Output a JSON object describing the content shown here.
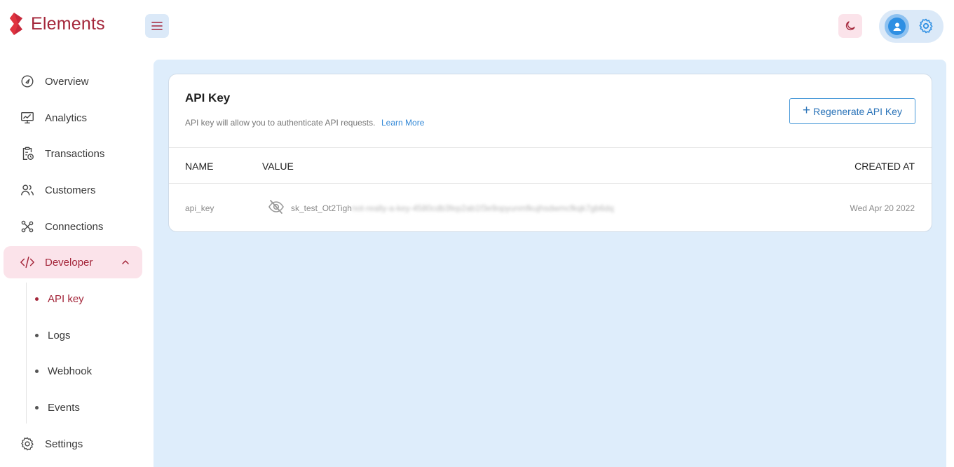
{
  "app": {
    "name": "Elements",
    "brand_color": "#a4263a",
    "accent_color": "#2f86d6"
  },
  "header": {
    "menu_icon": "hamburger-icon",
    "theme_icon": "moon-icon",
    "avatar_icon": "user-icon",
    "settings_icon": "gear-icon"
  },
  "sidebar": {
    "items": [
      {
        "label": "Overview",
        "icon": "gauge-icon"
      },
      {
        "label": "Analytics",
        "icon": "monitor-chart-icon"
      },
      {
        "label": "Transactions",
        "icon": "clipboard-clock-icon"
      },
      {
        "label": "Customers",
        "icon": "users-icon"
      },
      {
        "label": "Connections",
        "icon": "nodes-icon"
      },
      {
        "label": "Developer",
        "icon": "code-icon",
        "expanded": true
      },
      {
        "label": "Settings",
        "icon": "gear-icon"
      }
    ],
    "developer_subitems": [
      {
        "label": "API key",
        "active": true
      },
      {
        "label": "Logs"
      },
      {
        "label": "Webhook"
      },
      {
        "label": "Events"
      }
    ]
  },
  "card": {
    "title": "API Key",
    "description": "API key will allow you to authenticate API requests.",
    "learn_more": "Learn More",
    "regenerate_label": "Regenerate API Key",
    "table": {
      "headers": {
        "name": "NAME",
        "value": "VALUE",
        "created_at": "CREATED AT"
      },
      "rows": [
        {
          "name": "api_key",
          "value_visible": "sk_test_Ot2Tigh",
          "value_hidden": "not-really-a-key-4580cdb3fep2ab1f3e9opyunmfkujhsdwmcfkqk7gb6dq",
          "created_at": "Wed Apr 20 2022"
        }
      ]
    }
  }
}
